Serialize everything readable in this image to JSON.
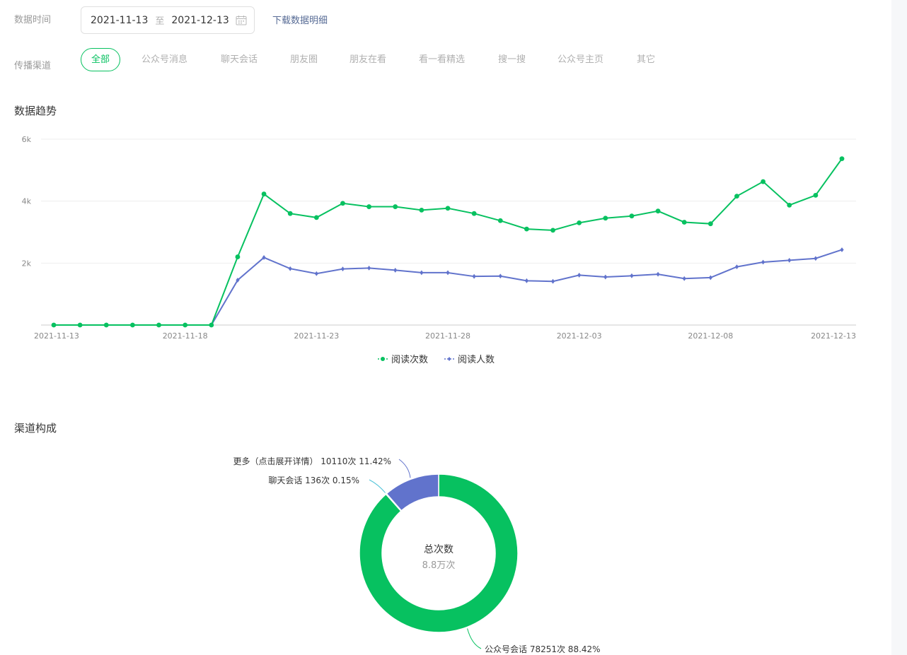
{
  "filters": {
    "date_label": "数据时间",
    "start_date": "2021-11-13",
    "range_sep": "至",
    "end_date": "2021-12-13",
    "calendar_icon": "calendar-icon",
    "download_link": "下载数据明细",
    "channel_label": "传播渠道",
    "channels": [
      "全部",
      "公众号消息",
      "聊天会话",
      "朋友圈",
      "朋友在看",
      "看一看精选",
      "搜一搜",
      "公众号主页",
      "其它"
    ],
    "active_channel": "全部"
  },
  "trend": {
    "title": "数据趋势",
    "chart_data": {
      "type": "line",
      "x": [
        "2021-11-13",
        "2021-11-14",
        "2021-11-15",
        "2021-11-16",
        "2021-11-17",
        "2021-11-18",
        "2021-11-19",
        "2021-11-20",
        "2021-11-21",
        "2021-11-22",
        "2021-11-23",
        "2021-11-24",
        "2021-11-25",
        "2021-11-26",
        "2021-11-27",
        "2021-11-28",
        "2021-11-29",
        "2021-11-30",
        "2021-12-01",
        "2021-12-02",
        "2021-12-03",
        "2021-12-04",
        "2021-12-05",
        "2021-12-06",
        "2021-12-07",
        "2021-12-08",
        "2021-12-09",
        "2021-12-10",
        "2021-12-11",
        "2021-12-12",
        "2021-12-13"
      ],
      "x_tick_labels": [
        "2021-11-13",
        "2021-11-18",
        "2021-11-23",
        "2021-11-28",
        "2021-12-03",
        "2021-12-08",
        "2021-12-13"
      ],
      "y_tick_labels": [
        "2k",
        "4k",
        "6k"
      ],
      "ylim": [
        0,
        6000
      ],
      "grid": true,
      "legend_position": "bottom",
      "series": [
        {
          "name": "阅读次数",
          "color": "#07c160",
          "marker": "circle",
          "values": [
            0,
            0,
            0,
            0,
            0,
            0,
            0,
            2200,
            4230,
            3600,
            3470,
            3930,
            3820,
            3820,
            3710,
            3770,
            3600,
            3370,
            3100,
            3060,
            3300,
            3450,
            3520,
            3680,
            3320,
            3270,
            4160,
            4630,
            3870,
            4190,
            5370
          ]
        },
        {
          "name": "阅读人数",
          "color": "#6173cc",
          "marker": "diamond",
          "values": [
            0,
            0,
            0,
            0,
            0,
            0,
            0,
            1450,
            2180,
            1820,
            1660,
            1810,
            1840,
            1770,
            1690,
            1690,
            1570,
            1580,
            1430,
            1410,
            1610,
            1550,
            1590,
            1640,
            1500,
            1530,
            1880,
            2030,
            2090,
            2150,
            2430
          ]
        }
      ]
    }
  },
  "composition": {
    "title": "渠道构成",
    "center_title": "总次数",
    "center_value": "8.8万次",
    "chart_data": {
      "type": "pie",
      "style": "donut",
      "slices": [
        {
          "label": "公众号会话 78251次 88.42%",
          "value": 78251,
          "percent": 88.42,
          "color": "#07c160"
        },
        {
          "label": "聊天会话 136次 0.15%",
          "value": 136,
          "percent": 0.15,
          "color": "#4fc3d9"
        },
        {
          "label": "更多（点击展开详情） 10110次 11.42%",
          "value": 10110,
          "percent": 11.42,
          "color": "#6173cc"
        }
      ]
    }
  }
}
